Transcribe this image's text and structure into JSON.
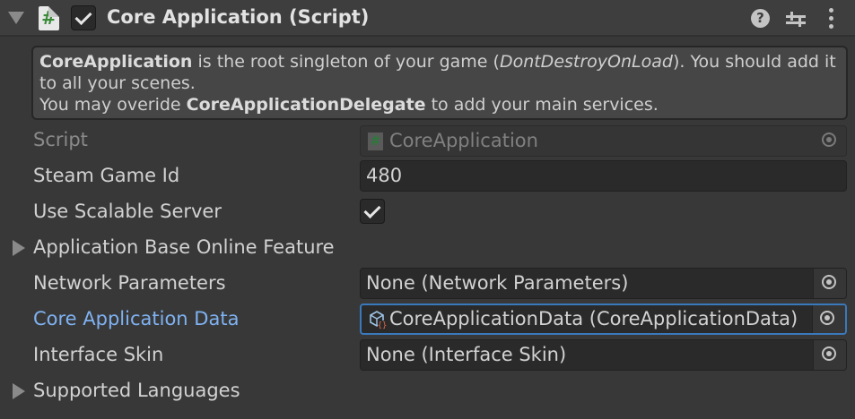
{
  "component": {
    "title": "Core Application (Script)",
    "enabled": true,
    "icons": {
      "foldout": "triangle-down-icon",
      "script": "csharp-script-icon",
      "help": "help-icon",
      "presets": "presets-sliders-icon",
      "menu": "kebab-menu-icon"
    }
  },
  "helpbox": {
    "line1_bold": "CoreApplication",
    "line1_text_a": " is the root singleton of your game (",
    "line1_italic": "DontDestroyOnLoad",
    "line1_text_b": "). You should add it to all your scenes.",
    "line2_text_a": "You may overide ",
    "line2_bold": "CoreApplicationDelegate",
    "line2_text_b": " to add your main services."
  },
  "fields": {
    "script": {
      "label": "Script",
      "value": "CoreApplication"
    },
    "steam_game_id": {
      "label": "Steam Game Id",
      "value": "480"
    },
    "use_scalable_server": {
      "label": "Use Scalable Server",
      "checked": true
    },
    "application_base_online_feature": {
      "label": "Application Base Online Feature"
    },
    "network_parameters": {
      "label": "Network Parameters",
      "value": "None (Network Parameters)"
    },
    "core_application_data": {
      "label": "Core Application Data",
      "value": "CoreApplicationData (CoreApplicationData)"
    },
    "interface_skin": {
      "label": "Interface Skin",
      "value": "None (Interface Skin)"
    },
    "supported_languages": {
      "label": "Supported Languages"
    }
  },
  "colors": {
    "background": "#383838",
    "header": "#3e3e3e",
    "field": "#2a2a2a",
    "highlight_label": "#7fb2f2",
    "highlight_border": "#3a79bb"
  }
}
